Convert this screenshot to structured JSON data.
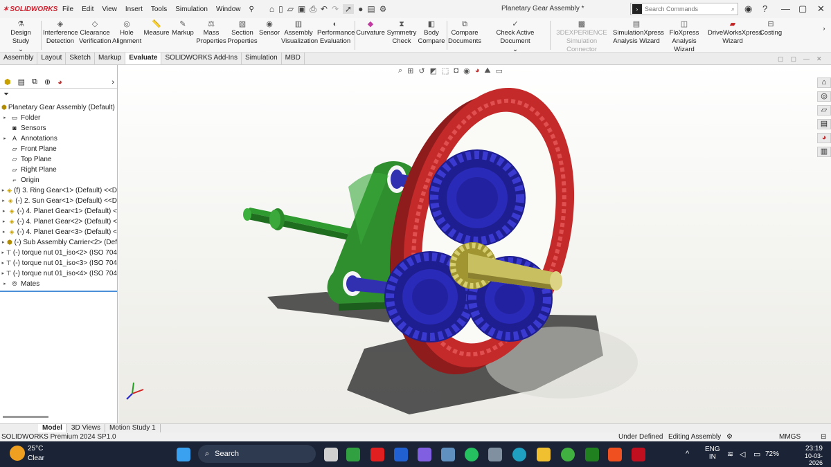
{
  "app": {
    "logo": "SOLIDWORKS",
    "menu": [
      "File",
      "Edit",
      "View",
      "Insert",
      "Tools",
      "Simulation",
      "Window"
    ],
    "doc_title": "Planetary Gear Assembly *",
    "search_placeholder": "Search Commands"
  },
  "ribbon": {
    "buttons": [
      {
        "label1": "Design Study",
        "label2": "",
        "icon": "design-study-icon"
      },
      {
        "label1": "Interference",
        "label2": "Detection",
        "icon": "interference-icon"
      },
      {
        "label1": "Clearance",
        "label2": "Verification",
        "icon": "clearance-icon"
      },
      {
        "label1": "Hole",
        "label2": "Alignment",
        "icon": "hole-icon"
      },
      {
        "label1": "Measure",
        "label2": "",
        "icon": "measure-icon"
      },
      {
        "label1": "Markup",
        "label2": "",
        "icon": "markup-icon"
      },
      {
        "label1": "Mass",
        "label2": "Properties",
        "icon": "mass-icon"
      },
      {
        "label1": "Section",
        "label2": "Properties",
        "icon": "section-icon"
      },
      {
        "label1": "Sensor",
        "label2": "",
        "icon": "sensor-icon"
      },
      {
        "label1": "Assembly",
        "label2": "Visualization",
        "icon": "assembly-vis-icon"
      },
      {
        "label1": "Performance",
        "label2": "Evaluation",
        "icon": "performance-icon"
      },
      {
        "label1": "Curvature",
        "label2": "",
        "icon": "curvature-icon"
      },
      {
        "label1": "Symmetry",
        "label2": "Check",
        "icon": "symmetry-icon"
      },
      {
        "label1": "Body",
        "label2": "Compare",
        "icon": "body-compare-icon"
      },
      {
        "label1": "Compare",
        "label2": "Documents",
        "icon": "compare-docs-icon"
      },
      {
        "label1": "Check Active Document",
        "label2": "",
        "icon": "check-doc-icon"
      },
      {
        "label1": "3DEXPERIENCE",
        "label2": "Simulation Connector",
        "icon": "3dx-icon"
      },
      {
        "label1": "SimulationXpress",
        "label2": "Analysis Wizard",
        "icon": "simxpress-icon"
      },
      {
        "label1": "FloXpress",
        "label2": "Analysis Wizard",
        "icon": "floxpress-icon"
      },
      {
        "label1": "DriveWorksXpress",
        "label2": "Wizard",
        "icon": "driveworks-icon"
      },
      {
        "label1": "Costing",
        "label2": "",
        "icon": "costing-icon"
      }
    ]
  },
  "tabs": [
    "Assembly",
    "Layout",
    "Sketch",
    "Markup",
    "Evaluate",
    "SOLIDWORKS Add-Ins",
    "Simulation",
    "MBD"
  ],
  "tree": {
    "root": "Planetary Gear Assembly (Default) <D",
    "items": [
      {
        "label": "Folder",
        "icon": "folder-icon"
      },
      {
        "label": "Sensors",
        "icon": "sensor-icon"
      },
      {
        "label": "Annotations",
        "icon": "annotation-icon"
      },
      {
        "label": "Front Plane",
        "icon": "plane-icon"
      },
      {
        "label": "Top Plane",
        "icon": "plane-icon"
      },
      {
        "label": "Right Plane",
        "icon": "plane-icon"
      },
      {
        "label": "Origin",
        "icon": "origin-icon"
      },
      {
        "label": "(f) 3. Ring Gear<1> (Default) <<D",
        "icon": "part-icon"
      },
      {
        "label": "(-) 2. Sun Gear<1> (Default) <<D",
        "icon": "part-icon"
      },
      {
        "label": "(-) 4. Planet Gear<1> (Default) <",
        "icon": "part-icon"
      },
      {
        "label": "(-) 4. Planet Gear<2> (Default) <",
        "icon": "part-icon"
      },
      {
        "label": "(-) 4. Planet Gear<3> (Default) <",
        "icon": "part-icon"
      },
      {
        "label": "(-) Sub Assembly Carrier<2> (Def",
        "icon": "subassembly-icon"
      },
      {
        "label": "(-) torque nut 01_iso<2> (ISO 704",
        "icon": "nut-icon"
      },
      {
        "label": "(-) torque nut 01_iso<3> (ISO 704",
        "icon": "nut-icon"
      },
      {
        "label": "(-) torque nut 01_iso<4> (ISO 704",
        "icon": "nut-icon"
      },
      {
        "label": "Mates",
        "icon": "mates-icon"
      }
    ]
  },
  "bottom_tabs": [
    "Model",
    "3D Views",
    "Motion Study 1"
  ],
  "status": {
    "left": "SOLIDWORKS Premium 2024 SP1.0",
    "state": "Under Defined",
    "mode": "Editing Assembly",
    "units": "MMGS"
  },
  "taskbar": {
    "temp": "25°C",
    "weather": "Clear",
    "search": "Search",
    "lang1": "ENG",
    "lang2": "IN",
    "battery": "72%",
    "time": "23:19",
    "date": "10-03-2026"
  },
  "colors": {
    "ring": "#c42a2a",
    "planet": "#2a2ab8",
    "sun": "#c8c060",
    "carrier": "#2e8a2e",
    "accent": "#d0202e"
  }
}
